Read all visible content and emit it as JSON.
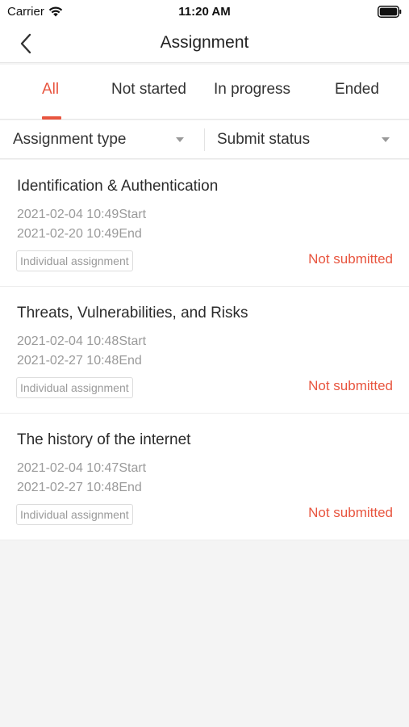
{
  "status_bar": {
    "carrier": "Carrier",
    "time": "11:20 AM"
  },
  "nav": {
    "title": "Assignment",
    "back_icon": "chevron-left-icon"
  },
  "tabs": [
    {
      "label": "All",
      "active": true
    },
    {
      "label": "Not started",
      "active": false
    },
    {
      "label": "In progress",
      "active": false
    },
    {
      "label": "Ended",
      "active": false
    }
  ],
  "filters": [
    {
      "label": "Assignment type",
      "icon": "caret-down-icon"
    },
    {
      "label": "Submit status",
      "icon": "caret-down-icon"
    }
  ],
  "assignments": [
    {
      "title": "Identification & Authentication",
      "start": "2021-02-04 10:49Start",
      "end": "2021-02-20 10:49End",
      "type": "Individual assignment",
      "status": "Not submitted"
    },
    {
      "title": "Threats, Vulnerabilities, and Risks",
      "start": "2021-02-04 10:48Start",
      "end": "2021-02-27 10:48End",
      "type": "Individual assignment",
      "status": "Not submitted"
    },
    {
      "title": "The history of the internet",
      "start": "2021-02-04 10:47Start",
      "end": "2021-02-27 10:48End",
      "type": "Individual assignment",
      "status": "Not submitted"
    }
  ],
  "colors": {
    "accent": "#e8553f",
    "muted_text": "#9a9a9a",
    "background": "#f4f4f4"
  }
}
